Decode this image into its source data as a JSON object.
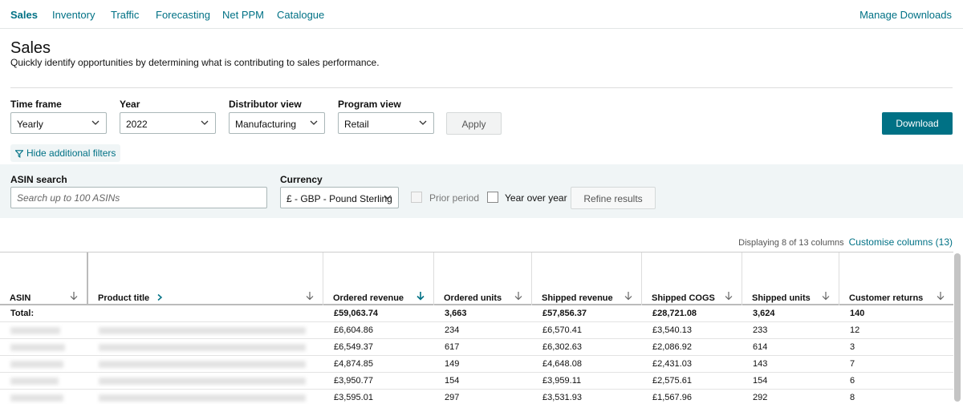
{
  "nav": {
    "tabs": [
      "Sales",
      "Inventory",
      "Traffic",
      "Forecasting",
      "Net PPM",
      "Catalogue"
    ],
    "active": "Sales",
    "manage_downloads": "Manage Downloads"
  },
  "header": {
    "title": "Sales",
    "subtitle": "Quickly identify opportunities by determining what is contributing to sales performance."
  },
  "filters": {
    "time_frame": {
      "label": "Time frame",
      "value": "Yearly"
    },
    "year": {
      "label": "Year",
      "value": "2022"
    },
    "distributor_view": {
      "label": "Distributor view",
      "value": "Manufacturing"
    },
    "program_view": {
      "label": "Program view",
      "value": "Retail"
    },
    "apply_label": "Apply",
    "download_label": "Download",
    "hide_filters_label": "Hide additional filters"
  },
  "additional": {
    "asin_label": "ASIN search",
    "asin_placeholder": "Search up to 100 ASINs",
    "currency_label": "Currency",
    "currency_value": "£ - GBP - Pound Sterling",
    "prior_period_label": "Prior period",
    "prior_period_checked": false,
    "prior_period_disabled": true,
    "yoy_label": "Year over year",
    "yoy_checked": false,
    "refine_label": "Refine results"
  },
  "table_info": {
    "displaying": "Displaying 8 of 13 columns",
    "customise": "Customise columns (13)"
  },
  "table": {
    "columns": [
      "ASIN",
      "Product title",
      "Ordered revenue",
      "Ordered units",
      "Shipped revenue",
      "Shipped COGS",
      "Shipped units",
      "Customer returns"
    ],
    "sorted_column": "Ordered revenue",
    "total": {
      "label": "Total:",
      "values": [
        "£59,063.74",
        "3,663",
        "£57,856.37",
        "£28,721.08",
        "3,624",
        "140"
      ]
    },
    "rows": [
      [
        "£6,604.86",
        "234",
        "£6,570.41",
        "£3,540.13",
        "233",
        "12"
      ],
      [
        "£6,549.37",
        "617",
        "£6,302.63",
        "£2,086.92",
        "614",
        "3"
      ],
      [
        "£4,874.85",
        "149",
        "£4,648.08",
        "£2,431.03",
        "143",
        "7"
      ],
      [
        "£3,950.77",
        "154",
        "£3,959.11",
        "£2,575.61",
        "154",
        "6"
      ],
      [
        "£3,595.01",
        "297",
        "£3,531.93",
        "£1,567.96",
        "292",
        "8"
      ]
    ]
  },
  "colors": {
    "accent": "#007185",
    "filter_bg": "#f0f5f6"
  }
}
